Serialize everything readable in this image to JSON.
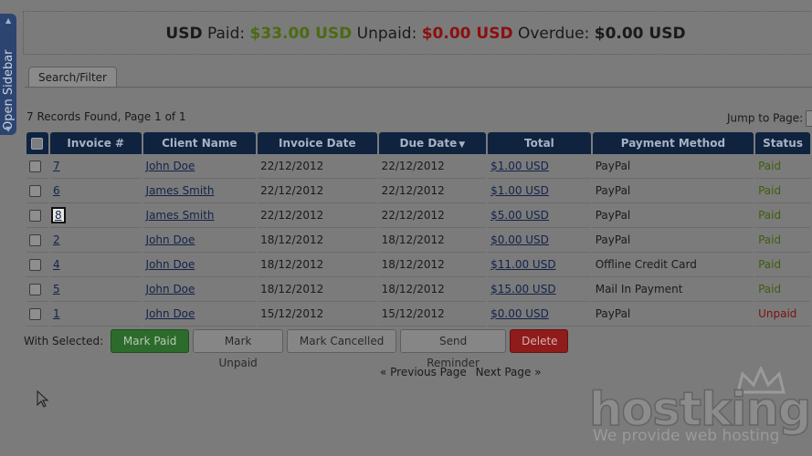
{
  "sidebar": {
    "label": "Open Sidebar"
  },
  "summary": {
    "currency": "USD",
    "paid_label": "Paid:",
    "paid_value": "$33.00 USD",
    "unpaid_label": "Unpaid:",
    "unpaid_value": "$0.00 USD",
    "overdue_label": "Overdue:",
    "overdue_value": "$0.00 USD"
  },
  "tabs": {
    "search_filter": "Search/Filter"
  },
  "records_text": "7 Records Found, Page 1 of 1",
  "jump_label": "Jump to Page:",
  "table": {
    "headers": {
      "invoice": "Invoice #",
      "client": "Client Name",
      "invoice_date": "Invoice Date",
      "due_date": "Due Date",
      "total": "Total",
      "method": "Payment Method",
      "status": "Status"
    },
    "rows": [
      {
        "invoice": "7",
        "client": "John Doe",
        "invoice_date": "22/12/2012",
        "due_date": "22/12/2012",
        "total": "$1.00 USD",
        "method": "PayPal",
        "status": "Paid"
      },
      {
        "invoice": "6",
        "client": "James Smith",
        "invoice_date": "22/12/2012",
        "due_date": "22/12/2012",
        "total": "$1.00 USD",
        "method": "PayPal",
        "status": "Paid"
      },
      {
        "invoice": "8",
        "client": "James Smith",
        "invoice_date": "22/12/2012",
        "due_date": "22/12/2012",
        "total": "$5.00 USD",
        "method": "PayPal",
        "status": "Paid"
      },
      {
        "invoice": "2",
        "client": "John Doe",
        "invoice_date": "18/12/2012",
        "due_date": "18/12/2012",
        "total": "$0.00 USD",
        "method": "PayPal",
        "status": "Paid"
      },
      {
        "invoice": "4",
        "client": "John Doe",
        "invoice_date": "18/12/2012",
        "due_date": "18/12/2012",
        "total": "$11.00 USD",
        "method": "Offline Credit Card",
        "status": "Paid"
      },
      {
        "invoice": "5",
        "client": "John Doe",
        "invoice_date": "18/12/2012",
        "due_date": "18/12/2012",
        "total": "$15.00 USD",
        "method": "Mail In Payment",
        "status": "Paid"
      },
      {
        "invoice": "1",
        "client": "John Doe",
        "invoice_date": "15/12/2012",
        "due_date": "15/12/2012",
        "total": "$0.00 USD",
        "method": "PayPal",
        "status": "Unpaid"
      }
    ]
  },
  "bulk": {
    "label": "With Selected:",
    "mark_paid": "Mark Paid",
    "mark_unpaid": "Mark Unpaid",
    "mark_cancelled": "Mark Cancelled",
    "send_reminder": "Send Reminder",
    "delete": "Delete"
  },
  "pager": {
    "prev": "« Previous Page",
    "next": "Next Page »"
  },
  "logo": {
    "word": "hostking",
    "tagline": "We provide web hosting"
  },
  "colors": {
    "header_bg": "#0f233f",
    "paid": "#3f5d10",
    "unpaid": "#801010",
    "mark_paid": "#2d6b2d",
    "delete": "#8f1b1b"
  }
}
